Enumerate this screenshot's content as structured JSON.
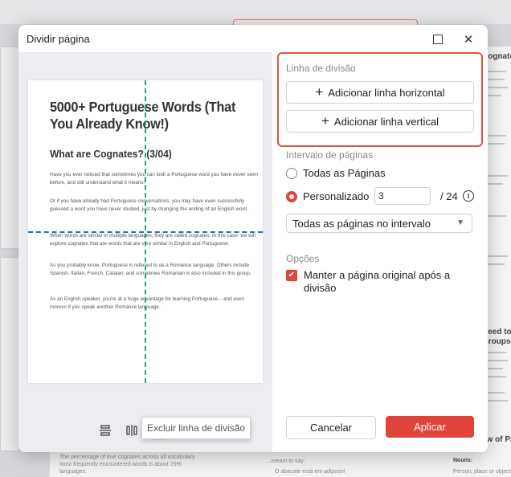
{
  "dialog": {
    "title": "Dividir página",
    "maximize_glyph": "",
    "close_glyph": "✕"
  },
  "preview": {
    "heading": "5000+ Portuguese Words (That You Already Know!)",
    "subheading": "What are Cognates? (3/04)",
    "paragraphs": [
      "Have you ever noticed that sometimes you can look a Portuguese word you have never seen before, and still understand what it means?",
      "Or if you have already had Portuguese conversations, you may have even successfully guessed a word you have never studied, just by changing the ending of an English word.",
      "When words are similar in multiple languages, they are called cognates. In this case, we will explore cognates that are words that are very similar in English and Portuguese.",
      "As you probably know, Portuguese is referred to as a Romance language. Others include Spanish, Italian, French, Catalan, and sometimes Romanian is also included in this group.",
      "As an English speaker, you're at a huge advantage for learning Portuguese – and even moreso if you speak another Romance language."
    ]
  },
  "toolbar": {
    "tooltip": "Excluir linha de divisão",
    "icons": [
      "split-horizontal-icon",
      "split-vertical-icon",
      "delete-line-icon",
      "delete-all-lines-icon"
    ]
  },
  "split_lines": {
    "section_label": "Linha de divisão",
    "add_horizontal": "Adicionar linha horizontal",
    "add_vertical": "Adicionar linha vertical"
  },
  "page_range": {
    "section_label": "Intervalo de páginas",
    "all_pages": "Todas as Páginas",
    "custom": "Personalizado",
    "custom_value": "3",
    "total": "/ 24",
    "selected_option": "Todas as páginas no intervalo"
  },
  "options": {
    "section_label": "Opções",
    "keep_original": "Manter a página original após a divisão",
    "keep_original_checked": true
  },
  "actions": {
    "cancel": "Cancelar",
    "apply": "Aplicar"
  },
  "background": {
    "right_title_1": "Need to R",
    "right_title_2": "Groups",
    "right_title_3": "Cognates",
    "right_title_4": "ew of Par",
    "bottom_text_1": "The percentage of true cognates across all vocabulary",
    "bottom_text_2": "most frequently encountered words is about 75%",
    "bottom_text_3": "languages.",
    "bottom_text_4": "...meant to say:",
    "bottom_text_5": "O abacate está em adiposo!",
    "bottom_text_6": "Nouns:",
    "bottom_text_7": "Person, place or object",
    "colors": {
      "accent": "#e0453d",
      "highlight_border": "#e0513f",
      "h_line": "#1a6fd6",
      "v_line": "#1aa87a"
    }
  }
}
